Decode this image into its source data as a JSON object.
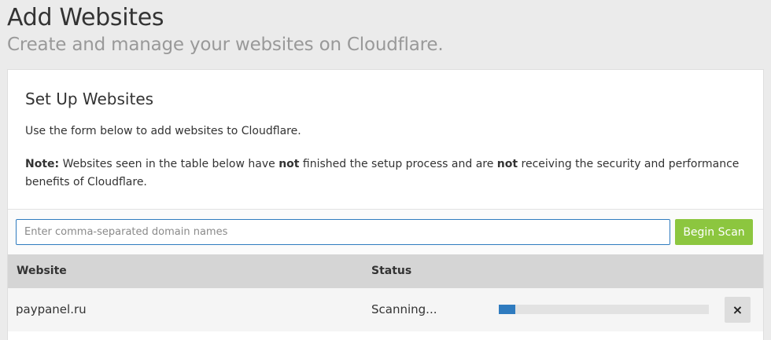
{
  "header": {
    "title": "Add Websites",
    "subtitle": "Create and manage your websites on Cloudflare."
  },
  "panel": {
    "title": "Set Up Websites",
    "intro": "Use the form below to add websites to Cloudflare.",
    "note": {
      "label": "Note:",
      "part1": " Websites seen in the table below have ",
      "emphasis1": "not",
      "part2": " finished the setup process and are ",
      "emphasis2": "not",
      "part3": " receiving the security and performance benefits of Cloudflare."
    }
  },
  "form": {
    "input_value": "",
    "input_placeholder": "Enter comma-separated domain names",
    "scan_button_label": "Begin Scan"
  },
  "table": {
    "columns": {
      "website": "Website",
      "status": "Status"
    },
    "rows": [
      {
        "website": "paypanel.ru",
        "status": "Scanning...",
        "progress_fraction": 0.08,
        "remove_icon": "×"
      }
    ]
  },
  "icons": {
    "remove": "close-icon"
  },
  "colors": {
    "accent_blue": "#2f7bbf",
    "button_green": "#8cc63f"
  }
}
